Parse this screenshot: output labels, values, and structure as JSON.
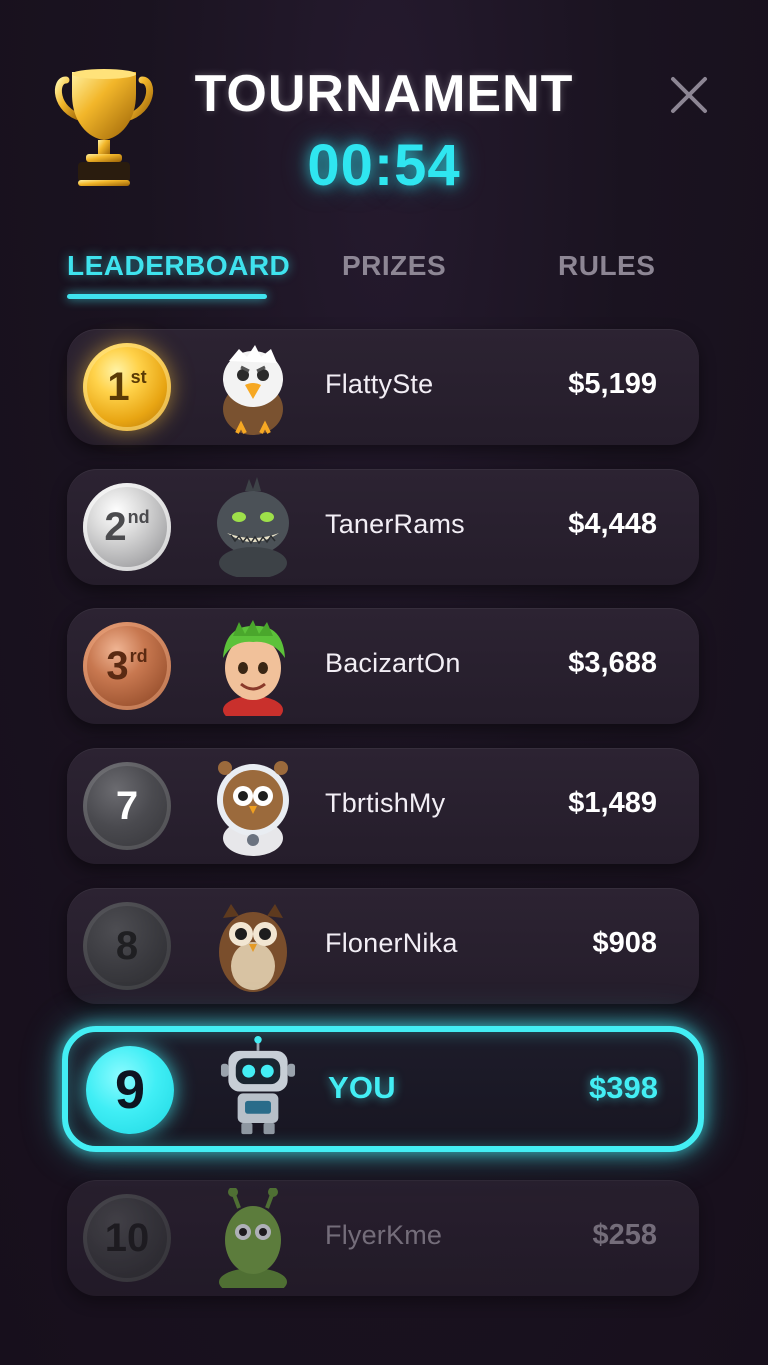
{
  "header": {
    "title": "TOURNAMENT",
    "timer": "00:54",
    "icons": {
      "trophy": "trophy-icon",
      "close": "close-icon"
    }
  },
  "tabs": [
    {
      "label": "LEADERBOARD",
      "active": true
    },
    {
      "label": "PRIZES",
      "active": false
    },
    {
      "label": "RULES",
      "active": false
    }
  ],
  "leaderboard": [
    {
      "rank": "1",
      "suffix": "st",
      "name": "FlattySte",
      "amount": "$5,199",
      "avatar": "eagle-avatar"
    },
    {
      "rank": "2",
      "suffix": "nd",
      "name": "TanerRams",
      "amount": "$4,448",
      "avatar": "monster-avatar"
    },
    {
      "rank": "3",
      "suffix": "rd",
      "name": "BacizartOn",
      "amount": "$3,688",
      "avatar": "boy-avatar"
    },
    {
      "rank": "7",
      "suffix": "",
      "name": "TbrtishMy",
      "amount": "$1,489",
      "avatar": "astronaut-owl-avatar"
    },
    {
      "rank": "8",
      "suffix": "",
      "name": "FlonerNika",
      "amount": "$908",
      "avatar": "owl-avatar"
    },
    {
      "rank": "9",
      "suffix": "",
      "name": "YOU",
      "amount": "$398",
      "avatar": "robot-avatar"
    },
    {
      "rank": "10",
      "suffix": "",
      "name": "FlyerKme",
      "amount": "$258",
      "avatar": "alien-avatar"
    }
  ],
  "colors": {
    "accent": "#43eef4",
    "background": "#1a1320",
    "row": "#2a2130",
    "gold": "#ffd24a",
    "silver": "#cfcfd2",
    "bronze": "#b86a42"
  }
}
